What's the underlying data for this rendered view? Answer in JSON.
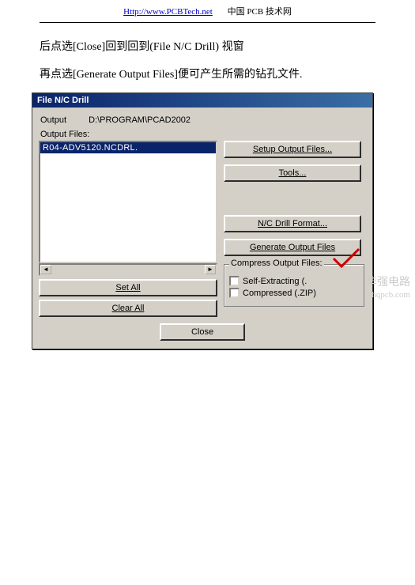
{
  "header": {
    "url": "Http://www.PCBTech.net",
    "site_title": "中国 PCB 技术网"
  },
  "text": {
    "line1": "后点选[Close]回到回到(File N/C Drill)  视窗",
    "line2": "再点选[Generate Output Files]便可产生所需的钻孔文件."
  },
  "dialog": {
    "title": "File N/C Drill",
    "output_label": "Output",
    "output_path": "D:\\PROGRAM\\PCAD2002",
    "files_label": "Output Files:",
    "list_item": "R04-ADV5120.NCDRL.",
    "set_all": "Set All",
    "clear_all": "Clear All",
    "setup": "Setup Output Files...",
    "tools": "Tools...",
    "nc_format": "N/C Drill Format...",
    "generate": "Generate Output Files",
    "group_title": "Compress Output Files:",
    "chk_self": "Self-Extracting (.",
    "chk_zip": "Compressed (.ZIP)",
    "close": "Close"
  },
  "watermark": {
    "cn": "华强电路",
    "en": "hqpcb.com"
  }
}
